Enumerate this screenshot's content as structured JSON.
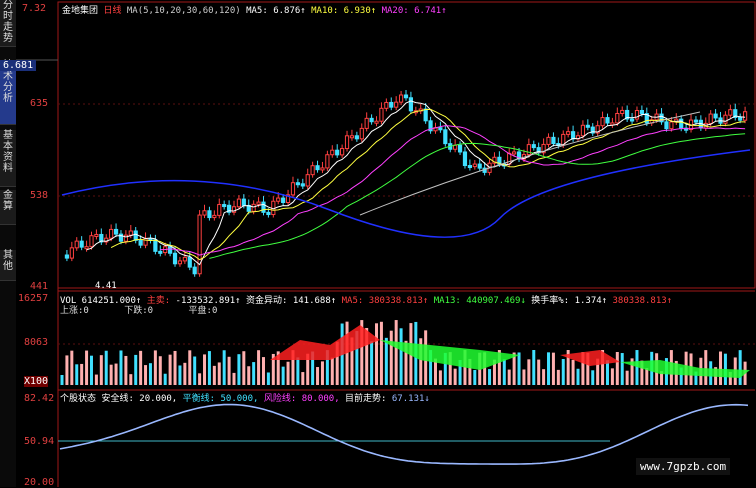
{
  "tabs": [
    "分时走势",
    "技术分析",
    "基本资料",
    "金算",
    "其他"
  ],
  "price_header": {
    "stock": "金地集团",
    "period": "日线",
    "ma_params": "MA(5,10,20,30,60,120)",
    "ma5_label": "MA5:",
    "ma5_value": "6.876↑",
    "ma10_label": "MA10:",
    "ma10_value": "6.930↑",
    "ma20_label": "MA20:",
    "ma20_value": "6.741↑"
  },
  "price_axis": {
    "top": "7.32",
    "current": "6.681",
    "t635": "635",
    "t538": "538",
    "t441": "441",
    "low_marker": "4.41"
  },
  "vol_header": {
    "vol": "VOL 614251.000↑",
    "main_label": "主卖:",
    "main_value": "-133532.891↑",
    "fund_label": "资金异动:",
    "fund_value": "141.688↑",
    "ma5": "MA5: 380338.813↑",
    "ma13": "MA13: 440907.469↓",
    "turnover_label": "换手率%:",
    "turnover_value": "1.374↑",
    "ma_extra": "380338.813↑",
    "row2_a": "上涨:0",
    "row2_b": "下跌:0",
    "row2_c": "平盘:0"
  },
  "vol_axis": {
    "top": "16257",
    "mid": "8063",
    "bottom": "X100"
  },
  "ind_header": {
    "name": "个股状态",
    "safe_label": "安全线:",
    "safe_value": "20.000,",
    "balance_label": "平衡线:",
    "balance_value": "50.000,",
    "risk_label": "风险线:",
    "risk_value": "80.000,",
    "trend_label": "目前走势:",
    "trend_value": "67.131↓"
  },
  "ind_axis": {
    "top": "82.42",
    "mid": "50.94",
    "bottom": "20.00"
  },
  "watermark": "www.7gpzb.com",
  "colors": {
    "up": "#ff4040",
    "down": "#40e0ff",
    "ma5": "#ffffff",
    "ma10": "#ffff40",
    "ma20": "#ff40ff",
    "ma30": "#40ff40",
    "ma60": "#c0c0c0",
    "ma120": "#2030ff"
  }
}
